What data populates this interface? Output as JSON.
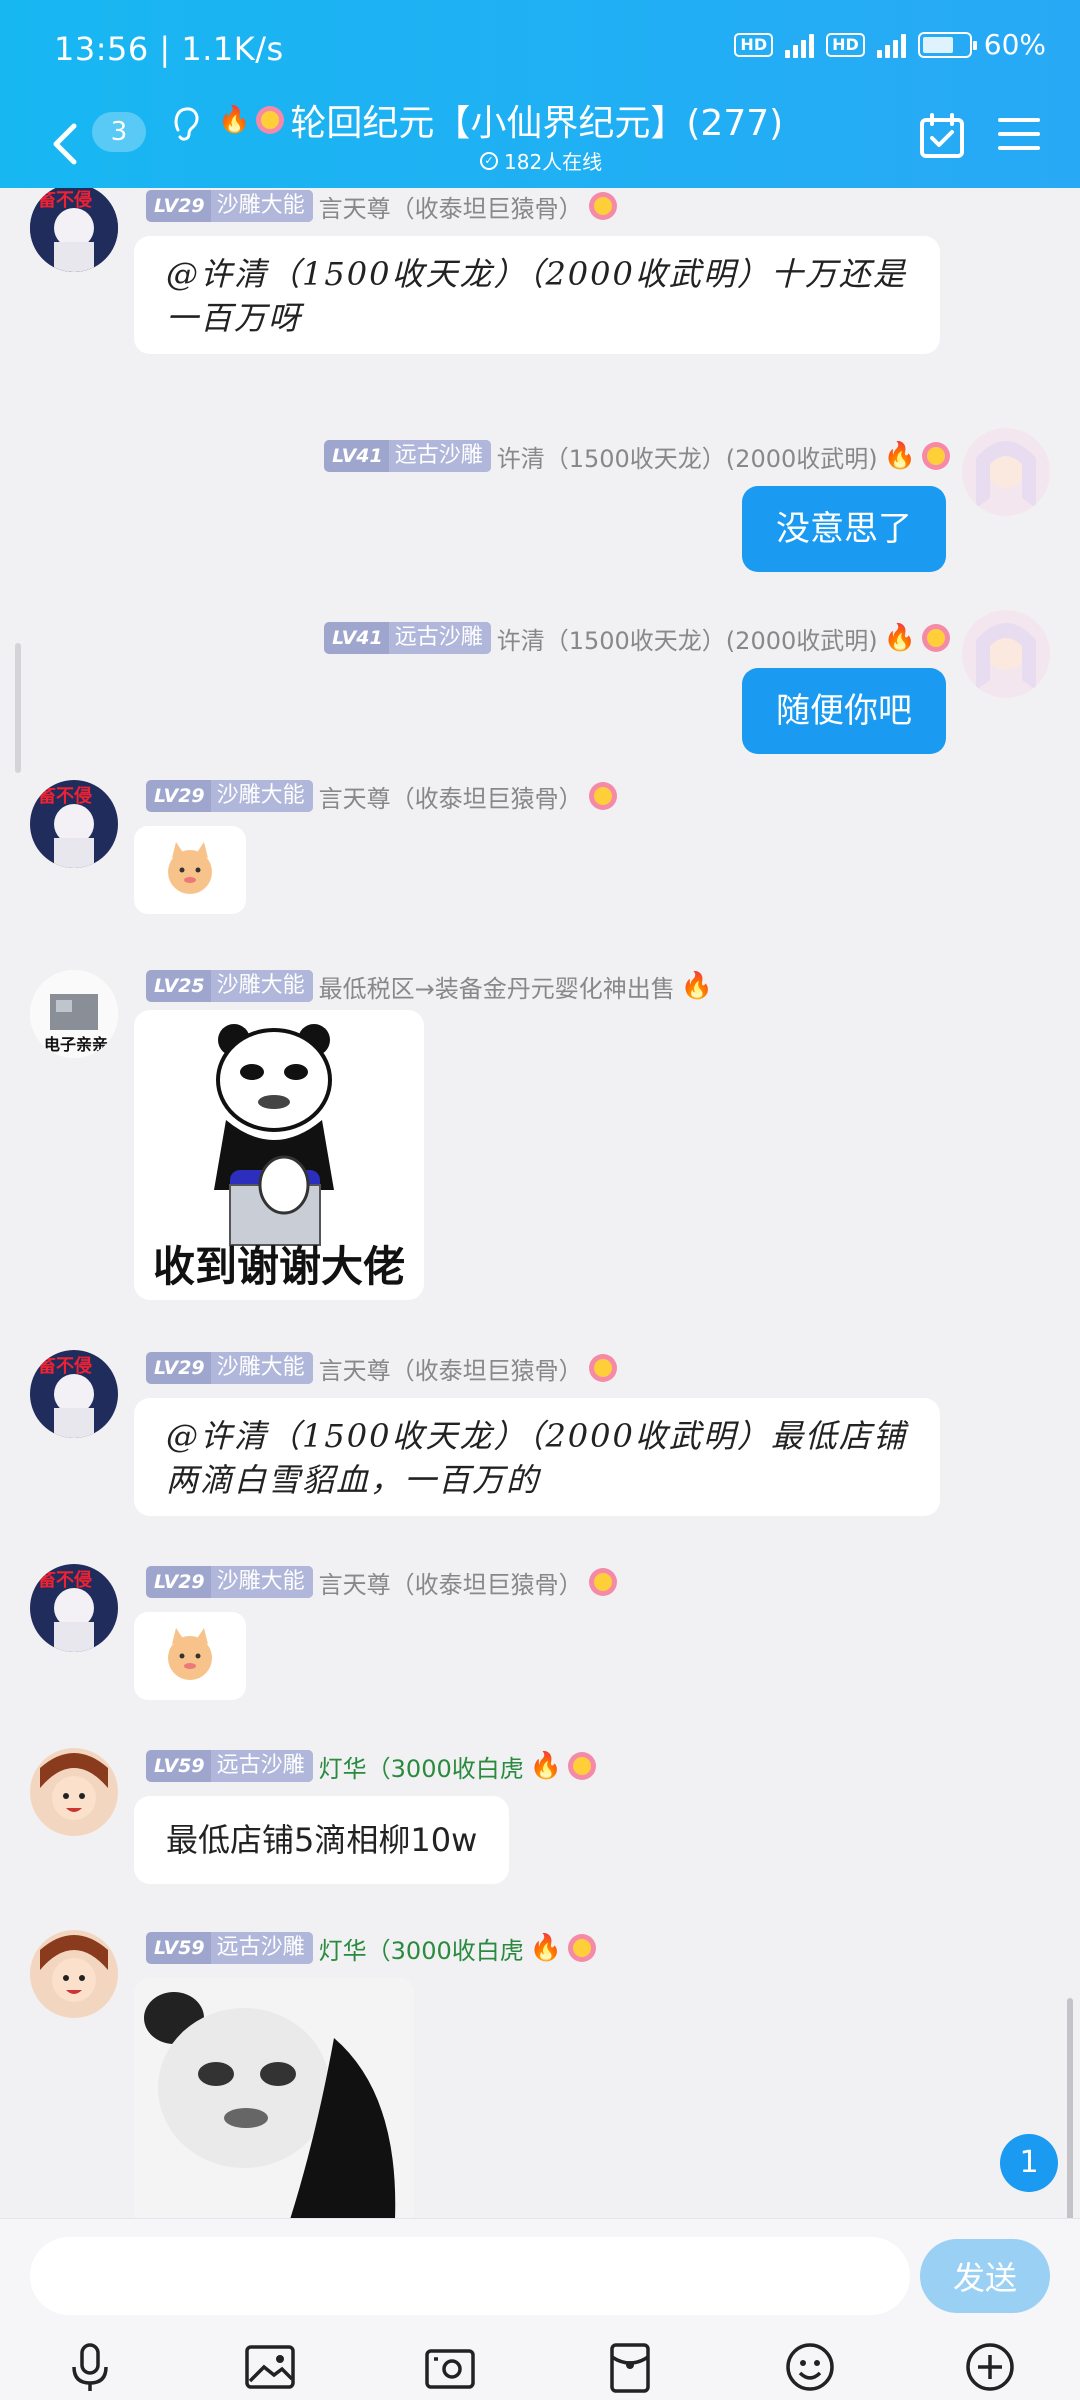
{
  "status": {
    "time": "13:56 | 1.1K/s",
    "net1": "HD",
    "net2": "HD",
    "battery": "60%"
  },
  "nav": {
    "unread_count": "3",
    "title": "轮回纪元【小仙界纪元】(277)",
    "online": "182人在线"
  },
  "messages": [
    {
      "level": "LV29",
      "rank": "沙雕大能",
      "nick": "言天尊（收泰坦巨猿骨）",
      "text": "@许清（1500收天龙）（2000收武明）十万还是一百万呀"
    },
    {
      "level": "LV41",
      "rank": "远古沙雕",
      "nick": "许清（1500收天龙）(2000收武明)",
      "text": "没意思了"
    },
    {
      "level": "LV41",
      "rank": "远古沙雕",
      "nick": "许清（1500收天龙）(2000收武明)",
      "text": "随便你吧"
    },
    {
      "level": "LV29",
      "rank": "沙雕大能",
      "nick": "言天尊（收泰坦巨猿骨）"
    },
    {
      "level": "LV25",
      "rank": "沙雕大能",
      "nick": "最低税区→装备金丹元婴化神出售",
      "caption": "收到谢谢大佬"
    },
    {
      "level": "LV29",
      "rank": "沙雕大能",
      "nick": "言天尊（收泰坦巨猿骨）",
      "text": "@许清（1500收天龙）（2000收武明）最低店铺两滴白雪貂血，一百万的"
    },
    {
      "level": "LV29",
      "rank": "沙雕大能",
      "nick": "言天尊（收泰坦巨猿骨）"
    },
    {
      "level": "LV59",
      "rank": "远古沙雕",
      "nick": "灯华（3000收白虎",
      "text": "最低店铺5滴相柳10w"
    },
    {
      "level": "LV59",
      "rank": "远古沙雕",
      "nick": "灯华（3000收白虎"
    }
  ],
  "new_message_count": "1",
  "input": {
    "placeholder": "",
    "send_label": "发送"
  },
  "toolbar": [
    "microphone-icon",
    "photo-icon",
    "camera-icon",
    "red-packet-icon",
    "emoji-icon",
    "plus-icon"
  ],
  "colors": {
    "header": "#17b7f2",
    "bubble_self": "#1a9af1",
    "level_tag": "#9ea6ce",
    "send_btn": "#9bd0f5"
  }
}
